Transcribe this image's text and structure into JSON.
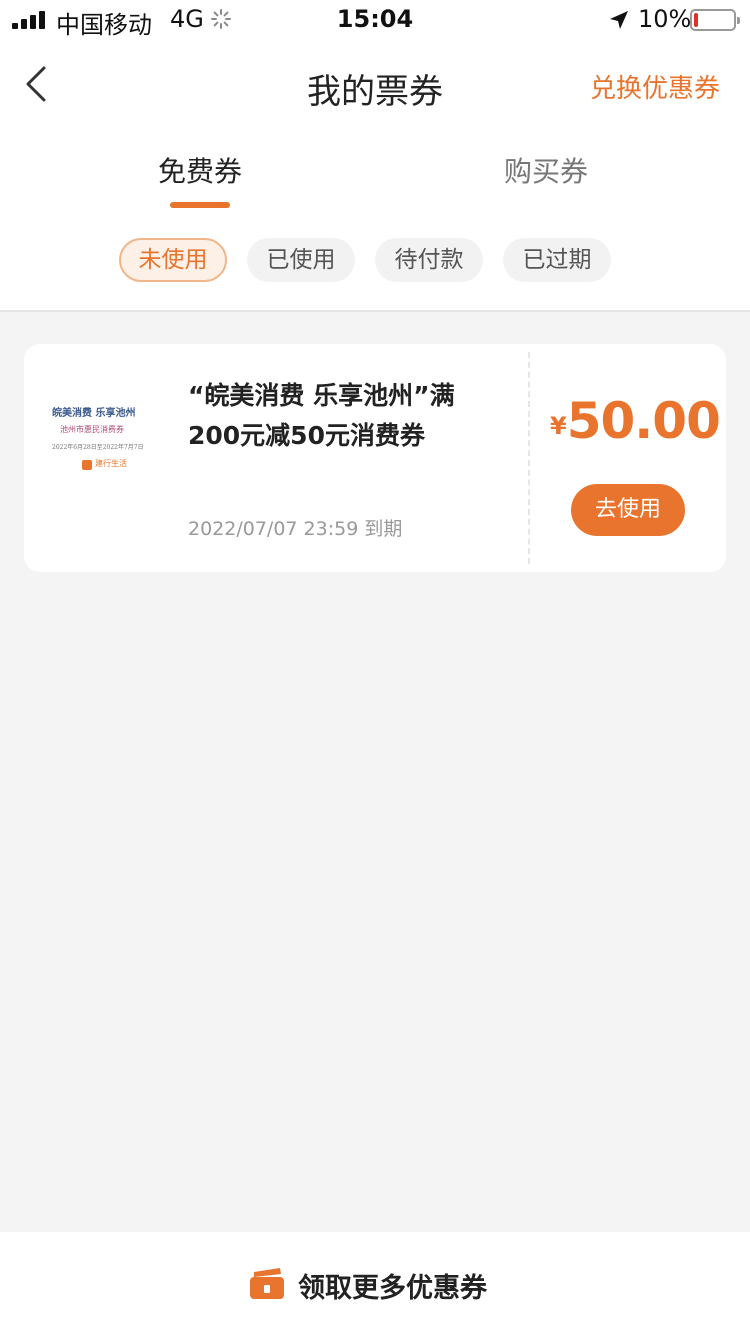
{
  "status_bar": {
    "carrier": "中国移动",
    "network": "4G",
    "time": "15:04",
    "battery_percent": "10%",
    "battery_level": 0.1,
    "icons": [
      "signal-icon",
      "loading-icon",
      "location-icon",
      "battery-icon"
    ]
  },
  "nav": {
    "back_icon": "chevron-left-icon",
    "title": "我的票券",
    "action": "兑换优惠券"
  },
  "tabs": [
    {
      "label": "免费券",
      "active": true
    },
    {
      "label": "购买券",
      "active": false
    }
  ],
  "filters": [
    {
      "label": "未使用",
      "active": true
    },
    {
      "label": "已使用",
      "active": false
    },
    {
      "label": "待付款",
      "active": false
    },
    {
      "label": "已过期",
      "active": false
    }
  ],
  "coupons": [
    {
      "thumbnail": {
        "line1": "皖美消费  乐享池州",
        "line2": "池州市惠民消费券",
        "line3": "2022年6月28日至2022年7月7日",
        "logo": "建行生活"
      },
      "name": "“皖美消费 乐享池州”满200元减50元消费券",
      "expiry": "2022/07/07 23:59 到期",
      "currency": "¥",
      "amount": "50.00",
      "button": "去使用"
    }
  ],
  "bottom": {
    "icon": "ticket-icon",
    "label": "领取更多优惠券"
  },
  "colors": {
    "accent": "#e8742d",
    "background": "#f4f4f4",
    "battery_low": "#e0302c"
  }
}
